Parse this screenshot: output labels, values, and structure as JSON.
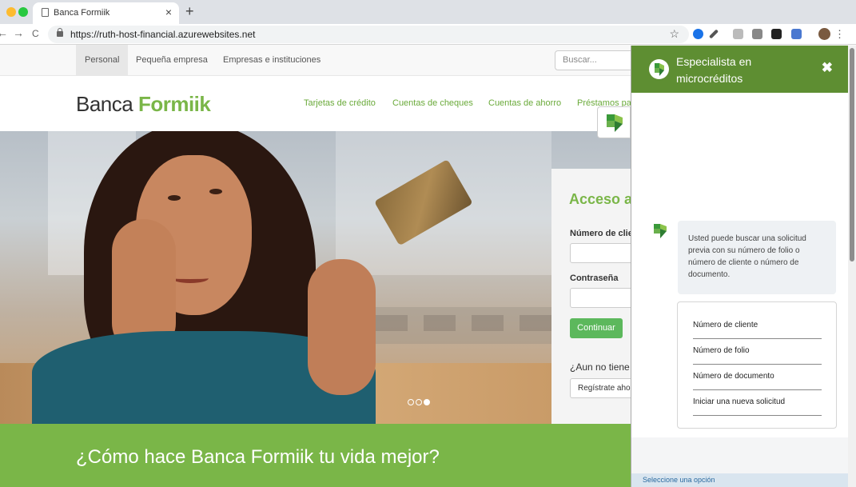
{
  "browser": {
    "tab_title": "Banca Formiik",
    "url": "https://ruth-host-financial.azurewebsites.net",
    "close_glyph": "×",
    "new_tab_glyph": "+",
    "back_glyph": "←",
    "forward_glyph": "→",
    "reload_glyph": "C",
    "star_glyph": "☆",
    "menu_glyph": "⋮",
    "icons": [
      "tab-page-icon",
      "lock-icon",
      "star-icon",
      "extension-icons",
      "kebab-menu-icon"
    ]
  },
  "subnav": {
    "items": [
      "Personal",
      "Pequeña empresa",
      "Empresas e instituciones"
    ],
    "search_placeholder": "Buscar..."
  },
  "header": {
    "logo_light": "Banca ",
    "logo_bold": "Formiik",
    "nav": [
      "Tarjetas de crédito",
      "Cuentas de cheques",
      "Cuentas de ahorro",
      "Préstamos pa"
    ]
  },
  "login": {
    "title": "Acceso a",
    "client_label": "Número de clie",
    "password_label": "Contraseña",
    "continue_button": "Continuar",
    "register_question": "¿Aun no tiene",
    "register_button": "Regístrate aho"
  },
  "band": {
    "text": "¿Cómo hace Banca Formiik tu vida mejor?"
  },
  "chat": {
    "title": "Especialista en microcréditos",
    "close_glyph": "✖",
    "message": "Usted puede buscar una solicitud previa con su número de folio o número de cliente o número de documento.",
    "options": [
      "Número de cliente",
      "Número de folio",
      "Número de documento",
      "Iniciar una nueva solicitud"
    ],
    "footer": "Seleccione una opción"
  },
  "colors": {
    "brand_green": "#7ab648",
    "chat_header": "#5e8e32",
    "button_green": "#5cb85c"
  }
}
